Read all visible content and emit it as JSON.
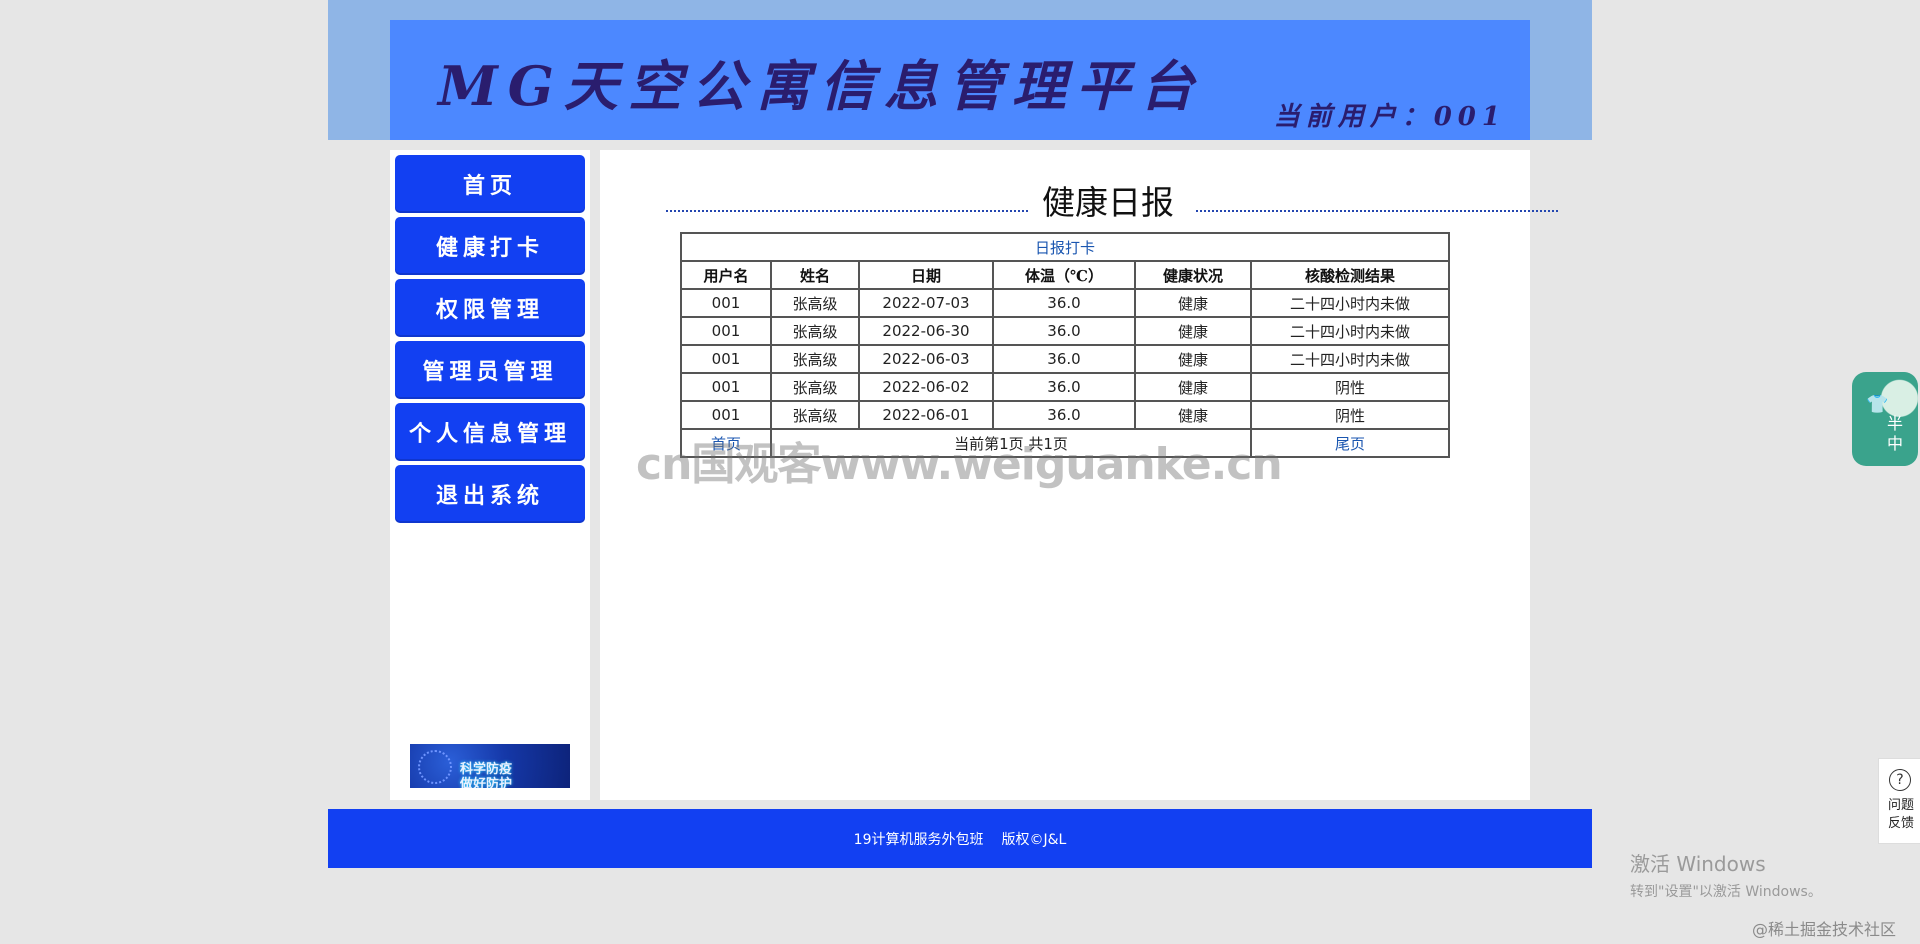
{
  "header": {
    "title": "MG天空公寓信息管理平台",
    "current_user": "当前用户：001"
  },
  "sidebar": {
    "items": [
      {
        "label": "首页"
      },
      {
        "label": "健康打卡"
      },
      {
        "label": "权限管理"
      },
      {
        "label": "管理员管理"
      },
      {
        "label": "个人信息管理"
      },
      {
        "label": "退出系统"
      }
    ],
    "promo_line1": "科学防疫",
    "promo_line2": "做好防护"
  },
  "main": {
    "title": "健康日报",
    "table": {
      "caption": "日报打卡",
      "columns": [
        "用户名",
        "姓名",
        "日期",
        "体温（℃）",
        "健康状况",
        "核酸检测结果"
      ],
      "rows": [
        [
          "001",
          "张高级",
          "2022-07-03",
          "36.0",
          "健康",
          "二十四小时内未做"
        ],
        [
          "001",
          "张高级",
          "2022-06-30",
          "36.0",
          "健康",
          "二十四小时内未做"
        ],
        [
          "001",
          "张高级",
          "2022-06-03",
          "36.0",
          "健康",
          "二十四小时内未做"
        ],
        [
          "001",
          "张高级",
          "2022-06-02",
          "36.0",
          "健康",
          "阴性"
        ],
        [
          "001",
          "张高级",
          "2022-06-01",
          "36.0",
          "健康",
          "阴性"
        ]
      ],
      "pagination": {
        "first": "首页",
        "info": "当前第1页 共1页",
        "last": "尾页"
      }
    }
  },
  "watermark": "cn国观客www.weiguanke.cn",
  "footer": {
    "class_name": "19计算机服务外包班",
    "copyright": "版权©J&L"
  },
  "widgets": {
    "side_text_1": "半",
    "side_text_2": "中",
    "feedback_symbol": "?",
    "feedback_line1": "问题",
    "feedback_line2": "反馈"
  },
  "os_overlay": {
    "activate_title": "激活 Windows",
    "activate_hint": "转到\"设置\"以激活 Windows。",
    "corner_mark": "@稀土掘金技术社区"
  },
  "colors": {
    "nav_blue": "#1240f2",
    "header_blue": "#4c88ff",
    "header_band": "#8fb5e6",
    "link_blue": "#1a56b0"
  }
}
